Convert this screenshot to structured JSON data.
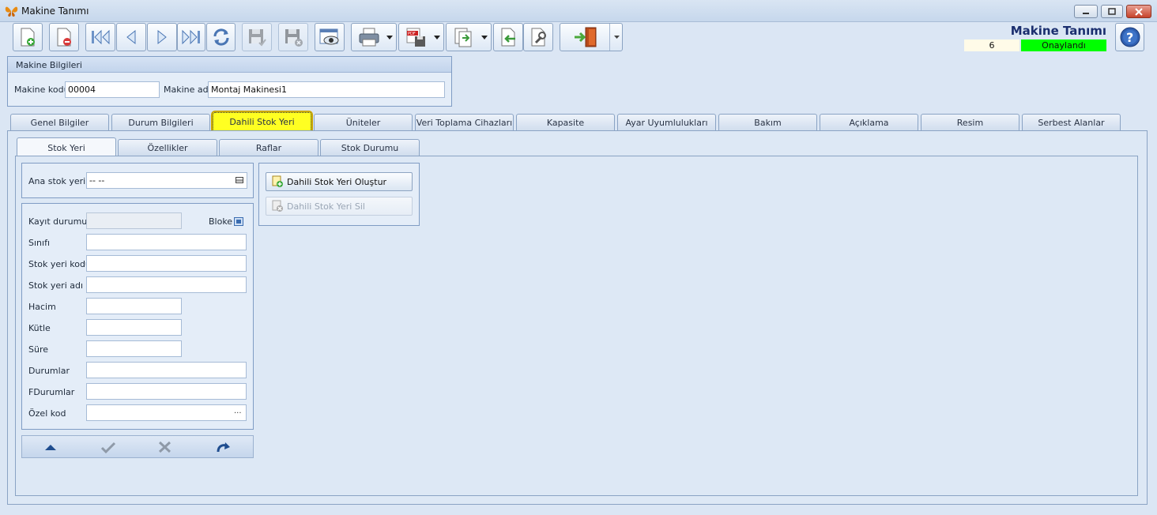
{
  "window": {
    "title": "Makine Tanımı",
    "app_icon": "butterfly-icon"
  },
  "header": {
    "title": "Makine Tanımı",
    "record_no": "6",
    "status": "Onaylandı",
    "status_color": "#00ff00"
  },
  "machine_info": {
    "group_title": "Makine Bilgileri",
    "code_label": "Makine kodu",
    "code_value": "00004",
    "name_label": "Makine adı",
    "name_value": "Montaj Makinesi1"
  },
  "tabs": [
    "Genel Bilgiler",
    "Durum Bilgileri",
    "Dahili Stok Yeri",
    "Üniteler",
    "Veri Toplama Cihazları",
    "Kapasite",
    "Ayar Uyumlulukları",
    "Bakım",
    "Açıklama",
    "Resim",
    "Serbest Alanlar"
  ],
  "active_tab": "Dahili Stok Yeri",
  "subtabs": [
    "Stok Yeri",
    "Özellikler",
    "Raflar",
    "Stok Durumu"
  ],
  "active_subtab": "Stok Yeri",
  "main_stock": {
    "label": "Ana stok yeri",
    "value": "-- --"
  },
  "form": {
    "kayit_durumu": "Kayıt durumu",
    "bloke": "Bloke",
    "sinifi": "Sınıfı",
    "stok_yeri_kodu": "Stok yeri kodu",
    "stok_yeri_adi": "Stok yeri adı",
    "hacim": "Hacim",
    "kutle": "Kütle",
    "sure": "Süre",
    "durumlar": "Durumlar",
    "fdurumlar": "FDurumlar",
    "ozel_kod": "Özel kod",
    "ozel_kod_button": "..."
  },
  "actions": {
    "create": "Dahili Stok Yeri Oluştur",
    "delete": "Dahili Stok Yeri Sil"
  },
  "toolbar_icons": [
    "new-record-icon",
    "delete-record-icon",
    "first-record-icon",
    "previous-record-icon",
    "next-record-icon",
    "last-record-icon",
    "refresh-icon",
    "save-icon",
    "cancel-save-icon",
    "preview-icon",
    "print-icon",
    "pdf-export-icon",
    "export-icon",
    "import-icon",
    "tools-icon",
    "exit-icon"
  ]
}
